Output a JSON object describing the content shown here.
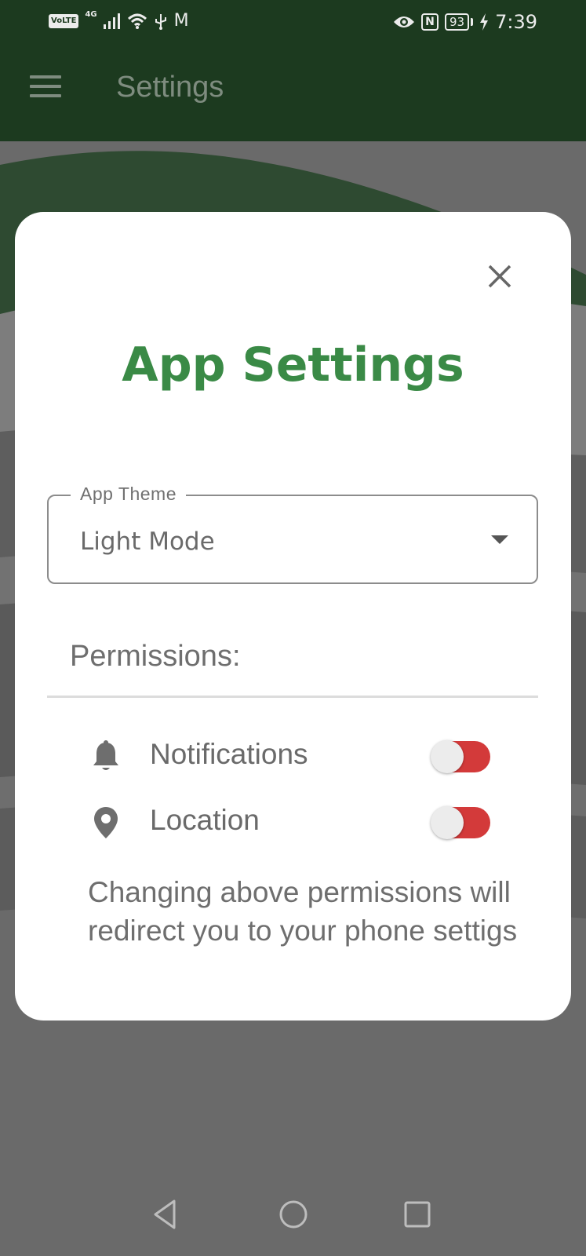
{
  "status_bar": {
    "volte": "VoLTE",
    "network": "4G",
    "mail": "M",
    "nfc": "N",
    "battery": "93",
    "time": "7:39"
  },
  "app_bar": {
    "title": "Settings",
    "menu_icon": "hamburger-menu-icon"
  },
  "dialog": {
    "title": "App Settings",
    "close_icon": "close-icon",
    "theme": {
      "label": "App Theme",
      "value": "Light Mode",
      "icon": "dropdown-arrow-icon"
    },
    "permissions": {
      "heading": "Permissions:",
      "items": [
        {
          "label": "Notifications",
          "icon": "bell-icon",
          "switch_color": "#d33a3a"
        },
        {
          "label": "Location",
          "icon": "location-pin-icon",
          "switch_color": "#d33a3a"
        }
      ],
      "note": "Changing above permissions will redirect you to your phone settigs"
    }
  },
  "nav_bar": {
    "back_icon": "back-triangle-icon",
    "home_icon": "home-circle-icon",
    "recents_icon": "recents-square-icon"
  },
  "colors": {
    "title_green": "#3a8a46",
    "header_green": "#1c3a1f",
    "switch_red": "#d33a3a",
    "scrim_gray": "#6a6a6a"
  }
}
